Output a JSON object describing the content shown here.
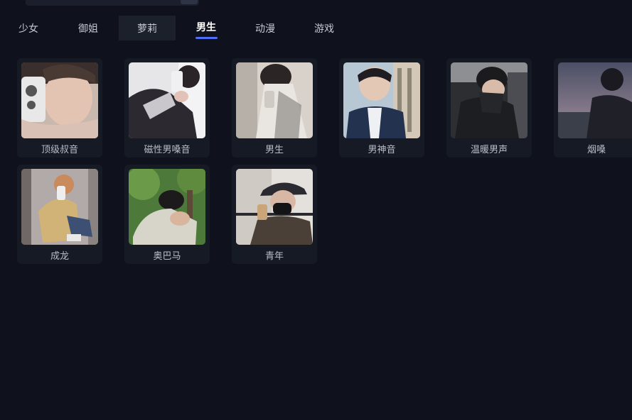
{
  "tabs": [
    {
      "label": "少女"
    },
    {
      "label": "御姐"
    },
    {
      "label": "萝莉"
    },
    {
      "label": "男生"
    },
    {
      "label": "动漫"
    },
    {
      "label": "游戏"
    }
  ],
  "active_tab": "男生",
  "hovered_tab": "萝莉",
  "accent_color": "#4f6ef7",
  "voices": [
    {
      "label": "顶级叔音"
    },
    {
      "label": "磁性男嗓音"
    },
    {
      "label": "男生"
    },
    {
      "label": "男神音"
    },
    {
      "label": "温暖男声"
    },
    {
      "label": "烟嗓"
    },
    {
      "label": "成龙"
    },
    {
      "label": "奥巴马"
    },
    {
      "label": "青年"
    }
  ]
}
